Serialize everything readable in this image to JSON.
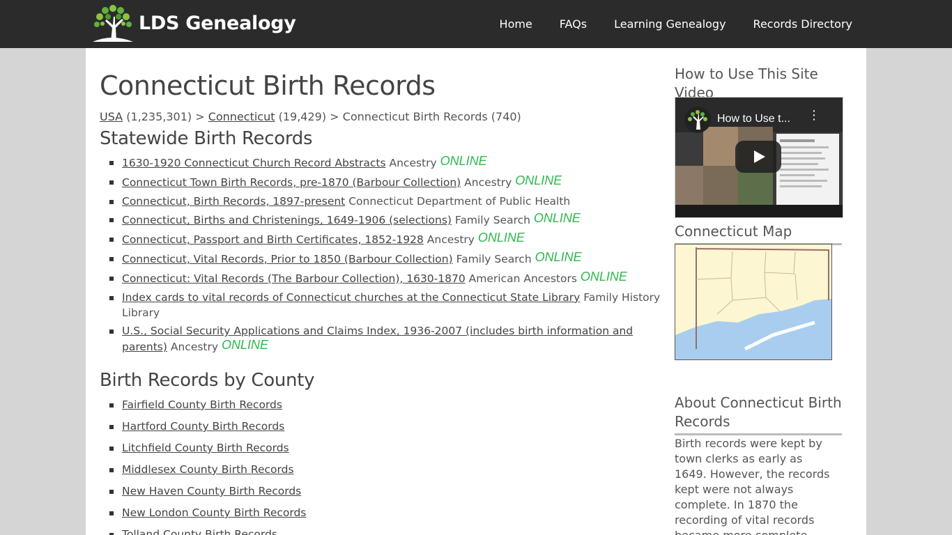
{
  "site": {
    "logo_text": "LDS Genealogy"
  },
  "nav": [
    {
      "label": "Home"
    },
    {
      "label": "FAQs"
    },
    {
      "label": "Learning Genealogy"
    },
    {
      "label": "Records Directory"
    }
  ],
  "page_title": "Connecticut Birth Records",
  "breadcrumb": {
    "usa_link": "USA",
    "usa_count": "(1,235,301) >",
    "ct_link": "Connecticut",
    "ct_count": "(19,429) >",
    "current": "Connecticut Birth Records (740)"
  },
  "statewide": {
    "heading": "Statewide Birth Records",
    "online_label": "ONLINE",
    "items": [
      {
        "link": "1630-1920 Connecticut Church Record Abstracts",
        "source": "Ancestry",
        "online": true
      },
      {
        "link": "Connecticut Town Birth Records, pre-1870 (Barbour Collection)",
        "source": "Ancestry",
        "online": true
      },
      {
        "link": "Connecticut, Birth Records, 1897-present",
        "source": "Connecticut Department of Public Health",
        "online": false
      },
      {
        "link": "Connecticut, Births and Christenings, 1649-1906 (selections)",
        "source": "Family Search",
        "online": true
      },
      {
        "link": "Connecticut, Passport and Birth Certificates, 1852-1928",
        "source": "Ancestry",
        "online": true
      },
      {
        "link": "Connecticut, Vital Records, Prior to 1850 (Barbour Collection)",
        "source": "Family Search",
        "online": true
      },
      {
        "link": "Connecticut: Vital Records (The Barbour Collection), 1630-1870",
        "source": "American Ancestors",
        "online": true
      },
      {
        "link": "Index cards to vital records of Connecticut churches at the Connecticut State Library",
        "source": "Family History Library",
        "online": false
      },
      {
        "link": "U.S., Social Security Applications and Claims Index, 1936-2007 (includes birth information and parents)",
        "source": "Ancestry",
        "online": true
      }
    ]
  },
  "county": {
    "heading": "Birth Records by County",
    "items": [
      "Fairfield County Birth Records",
      "Hartford County Birth Records",
      "Litchfield County Birth Records",
      "Middlesex County Birth Records",
      "New Haven County Birth Records",
      "New London County Birth Records",
      "Tolland County Birth Records"
    ]
  },
  "sidebar": {
    "video_heading": "How to Use This Site Video",
    "video_title": "How to Use t...",
    "map_heading": "Connecticut Map",
    "about_heading": "About Connecticut Birth Records",
    "about_text": "Birth records were kept by town clerks as early as 1649. However, the records kept were not always complete. In 1870 the recording of vital records became more complete. Statewide birth"
  }
}
